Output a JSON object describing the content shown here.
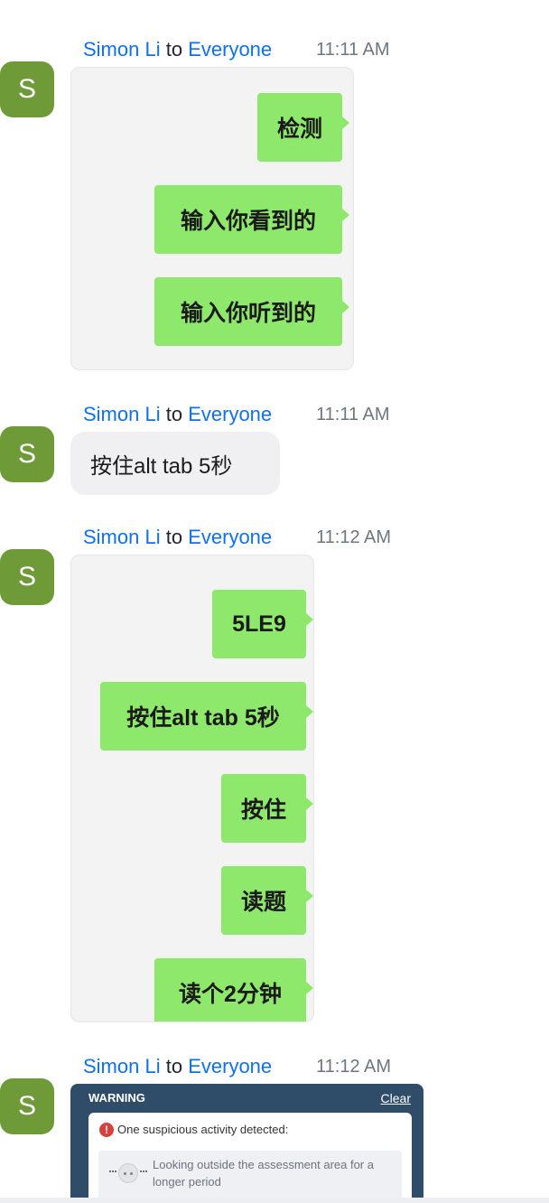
{
  "messages": [
    {
      "sender": "Simon Li",
      "connector": "to",
      "recipient": "Everyone",
      "time": "11:11 AM",
      "avatar_letter": "S",
      "image_bubbles": [
        "检测",
        "输入你看到的",
        "输入你听到的"
      ]
    },
    {
      "sender": "Simon Li",
      "connector": "to",
      "recipient": "Everyone",
      "time": "11:11 AM",
      "avatar_letter": "S",
      "text": "按住alt tab 5秒"
    },
    {
      "sender": "Simon Li",
      "connector": "to",
      "recipient": "Everyone",
      "time": "11:12 AM",
      "avatar_letter": "S",
      "image_bubbles": [
        "5LE9",
        "按住alt tab 5秒",
        "按住",
        "读题",
        "读个2分钟"
      ]
    },
    {
      "sender": "Simon Li",
      "connector": "to",
      "recipient": "Everyone",
      "time": "11:12 AM",
      "avatar_letter": "S",
      "warning": {
        "title": "WARNING",
        "clear_label": "Clear",
        "alert_icon": "!",
        "message": "One suspicious activity detected:",
        "item_text": "Looking outside the assessment area for a longer period"
      }
    }
  ],
  "colors": {
    "avatar": "#6f9a38",
    "name_link": "#0e71eb",
    "chat_bubble_green": "#8ee86b",
    "warning_header": "#2f4c69",
    "alert_red": "#d9403a"
  }
}
